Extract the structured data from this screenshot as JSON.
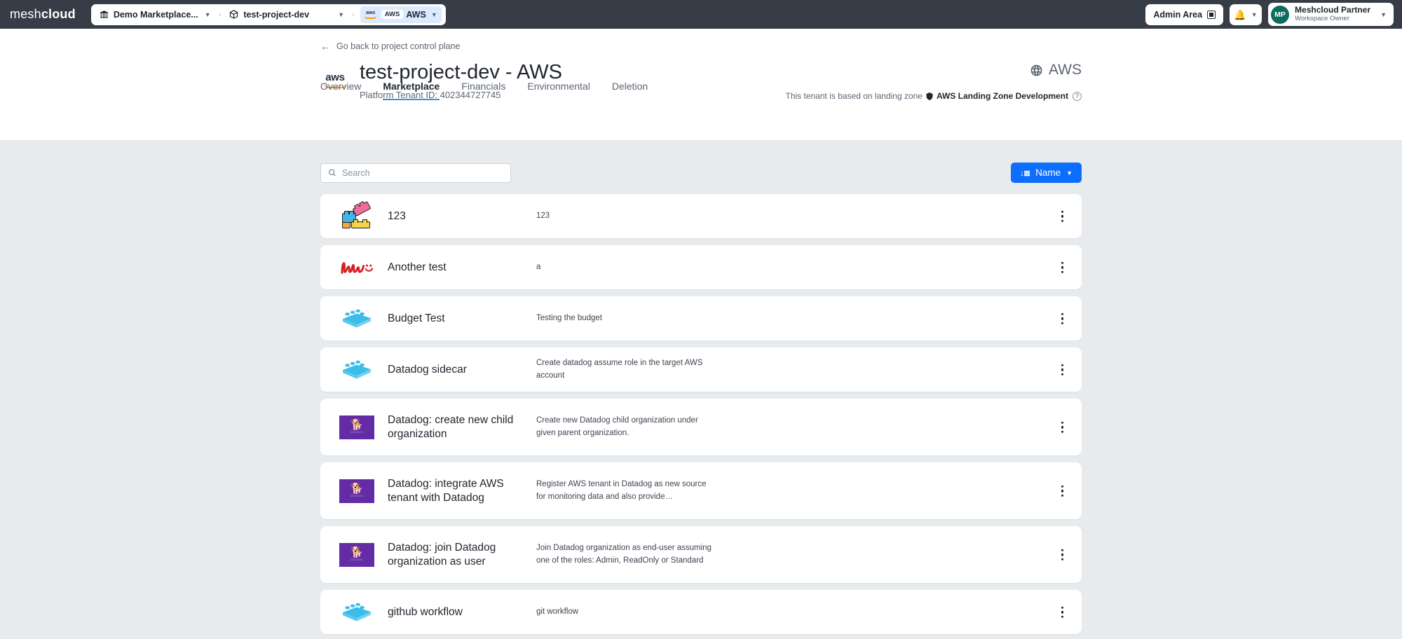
{
  "topbar": {
    "brand_light": "mesh",
    "brand_bold": "cloud",
    "breadcrumb": {
      "org_label": "Demo Marketplace...",
      "org_icon": "bank-icon",
      "project_label": "test-project-dev",
      "project_icon": "cube-icon",
      "platform_logo_label": "aws",
      "platform_chip_label": "AWS",
      "platform_label": "AWS",
      "separator": "›",
      "caret": "▼"
    },
    "admin_area_label": "Admin Area",
    "notifications_icon": "bell-icon",
    "user": {
      "initials": "MP",
      "name": "Meshcloud Partner",
      "role": "Workspace Owner"
    }
  },
  "header": {
    "back_link": "Go back to project control plane",
    "back_icon": "arrow-left-icon",
    "platform_logo": "aws-logo",
    "platform_logo_text": "aws",
    "title": "test-project-dev - AWS",
    "tenant_id_label": "Platform Tenant ID: 402344727745",
    "cloud_name": "AWS",
    "cloud_icon": "globe-icon",
    "landing_zone_prefix": "This tenant is based on landing zone",
    "landing_zone_icon": "shield-icon",
    "landing_zone_name": "AWS Landing Zone Development",
    "help_icon": "question-mark-icon"
  },
  "tabs": [
    {
      "label": "Overview",
      "active": false
    },
    {
      "label": "Marketplace",
      "active": true
    },
    {
      "label": "Financials",
      "active": false
    },
    {
      "label": "Environmental",
      "active": false
    },
    {
      "label": "Deletion",
      "active": false
    }
  ],
  "toolbar": {
    "search_placeholder": "Search",
    "search_value": "",
    "search_icon": "search-icon",
    "sort_label": "Name",
    "sort_icon": "sort-ascending-icon",
    "sort_caret": "▼",
    "accent_color": "#0d6efd"
  },
  "items": [
    {
      "name": "123",
      "description": "123",
      "icon": "lego-bricks-icon",
      "tall": false
    },
    {
      "name": "Another test",
      "description": "a",
      "icon": "hello-handwritten-icon",
      "tall": false
    },
    {
      "name": "Budget Test",
      "description": "Testing the budget",
      "icon": "lego-brick-blue-icon",
      "tall": false
    },
    {
      "name": "Datadog sidecar",
      "description": "Create datadog assume role in the target AWS account",
      "icon": "lego-brick-blue-icon",
      "tall": false
    },
    {
      "name": "Datadog: create new child organization",
      "description": "Create new Datadog child organization under given parent organization.",
      "icon": "datadog-icon",
      "tall": true
    },
    {
      "name": "Datadog: integrate AWS tenant with Datadog",
      "description": "Register AWS tenant in Datadog as new source for monitoring data and also provide…",
      "icon": "datadog-icon",
      "tall": true
    },
    {
      "name": "Datadog: join Datadog organization as user",
      "description": "Join Datadog organization as end-user assuming one of the roles: Admin, ReadOnly or Standard",
      "icon": "datadog-icon",
      "tall": true
    },
    {
      "name": "github workflow",
      "description": "git workflow",
      "icon": "lego-brick-blue-icon",
      "tall": false
    }
  ],
  "card_menu_icon": "kebab-menu-icon",
  "datadog_tile": {
    "glyph": "🐕",
    "watermark": "DATADOG"
  }
}
